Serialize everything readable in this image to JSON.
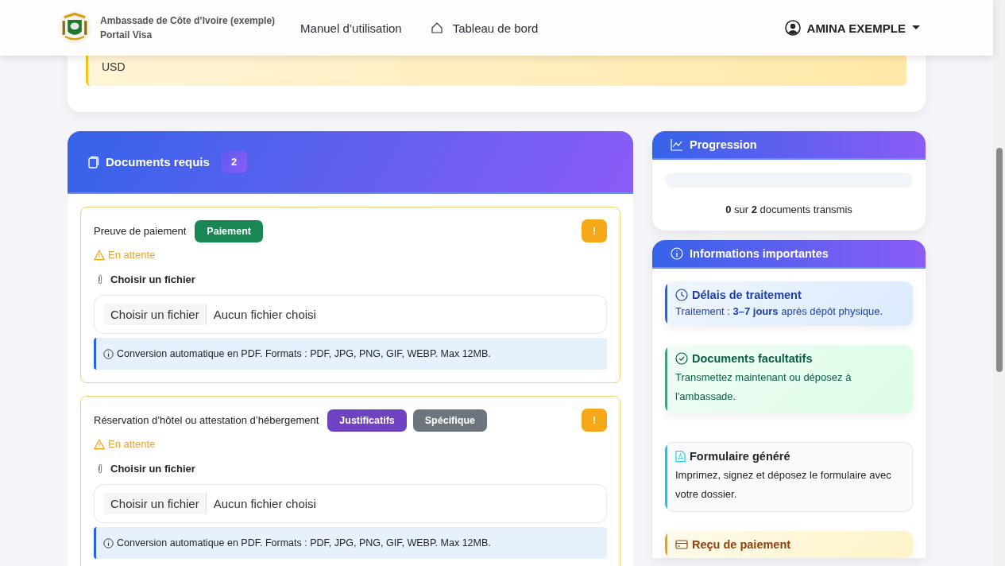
{
  "header": {
    "brand_title": "Ambassade de Côte d’Ivoire (exemple)",
    "brand_subtitle": "Portail Visa",
    "nav": [
      {
        "label": "Manuel d’utilisation",
        "kind": "plain"
      },
      {
        "label": "Tableau de bord",
        "kind": "home"
      }
    ],
    "user": "AMINA EXEMPLE"
  },
  "top_alert": {
    "text": "USD"
  },
  "documents": {
    "title": "Documents requis",
    "count": "2",
    "items": [
      {
        "name": "Preuve de paiement",
        "tags": [
          {
            "label": "Paiement",
            "color": "#198754"
          }
        ],
        "badge": "!",
        "status": "En attente",
        "file_label": "Choisir un fichier",
        "file_button": "Choisir un fichier",
        "file_value": "Aucun fichier choisi",
        "hint": "Conversion automatique en PDF. Formats : PDF, JPG, PNG, GIF, WEBP. Max 12MB."
      },
      {
        "name": "Réservation d’hôtel ou attestation d’hébergement",
        "tags": [
          {
            "label": "Justificatifs",
            "color": "#6f42c1"
          },
          {
            "label": "Spécifique",
            "color": "#6c757d"
          }
        ],
        "badge": "!",
        "status": "En attente",
        "file_label": "Choisir un fichier",
        "file_button": "Choisir un fichier",
        "file_value": "Aucun fichier choisi",
        "hint": "Conversion automatique en PDF. Formats : PDF, JPG, PNG, GIF, WEBP. Max 12MB."
      }
    ]
  },
  "progress": {
    "title": "Progression",
    "level": 0,
    "summary": "**0** sur **2** documents transmis"
  },
  "info": {
    "title": "Informations importantes",
    "items": [
      {
        "kind": "clock",
        "title": "Délais de traitement",
        "text": "Traitement : **3–7 jours** après dépôt physique.",
        "color": "#2563eb"
      },
      {
        "kind": "check",
        "title": "Documents facultatifs",
        "text": "Transmettez maintenant ou déposez à l'ambassade.",
        "color": "#10b981"
      },
      {
        "kind": "pdf",
        "title": "Formulaire généré",
        "text": "Imprimez, signez et déposez le formulaire avec votre dossier.",
        "color": "#0dcaf0"
      },
      {
        "kind": "card",
        "title": "Reçu de paiement",
        "color": "#f59e0b"
      }
    ]
  }
}
